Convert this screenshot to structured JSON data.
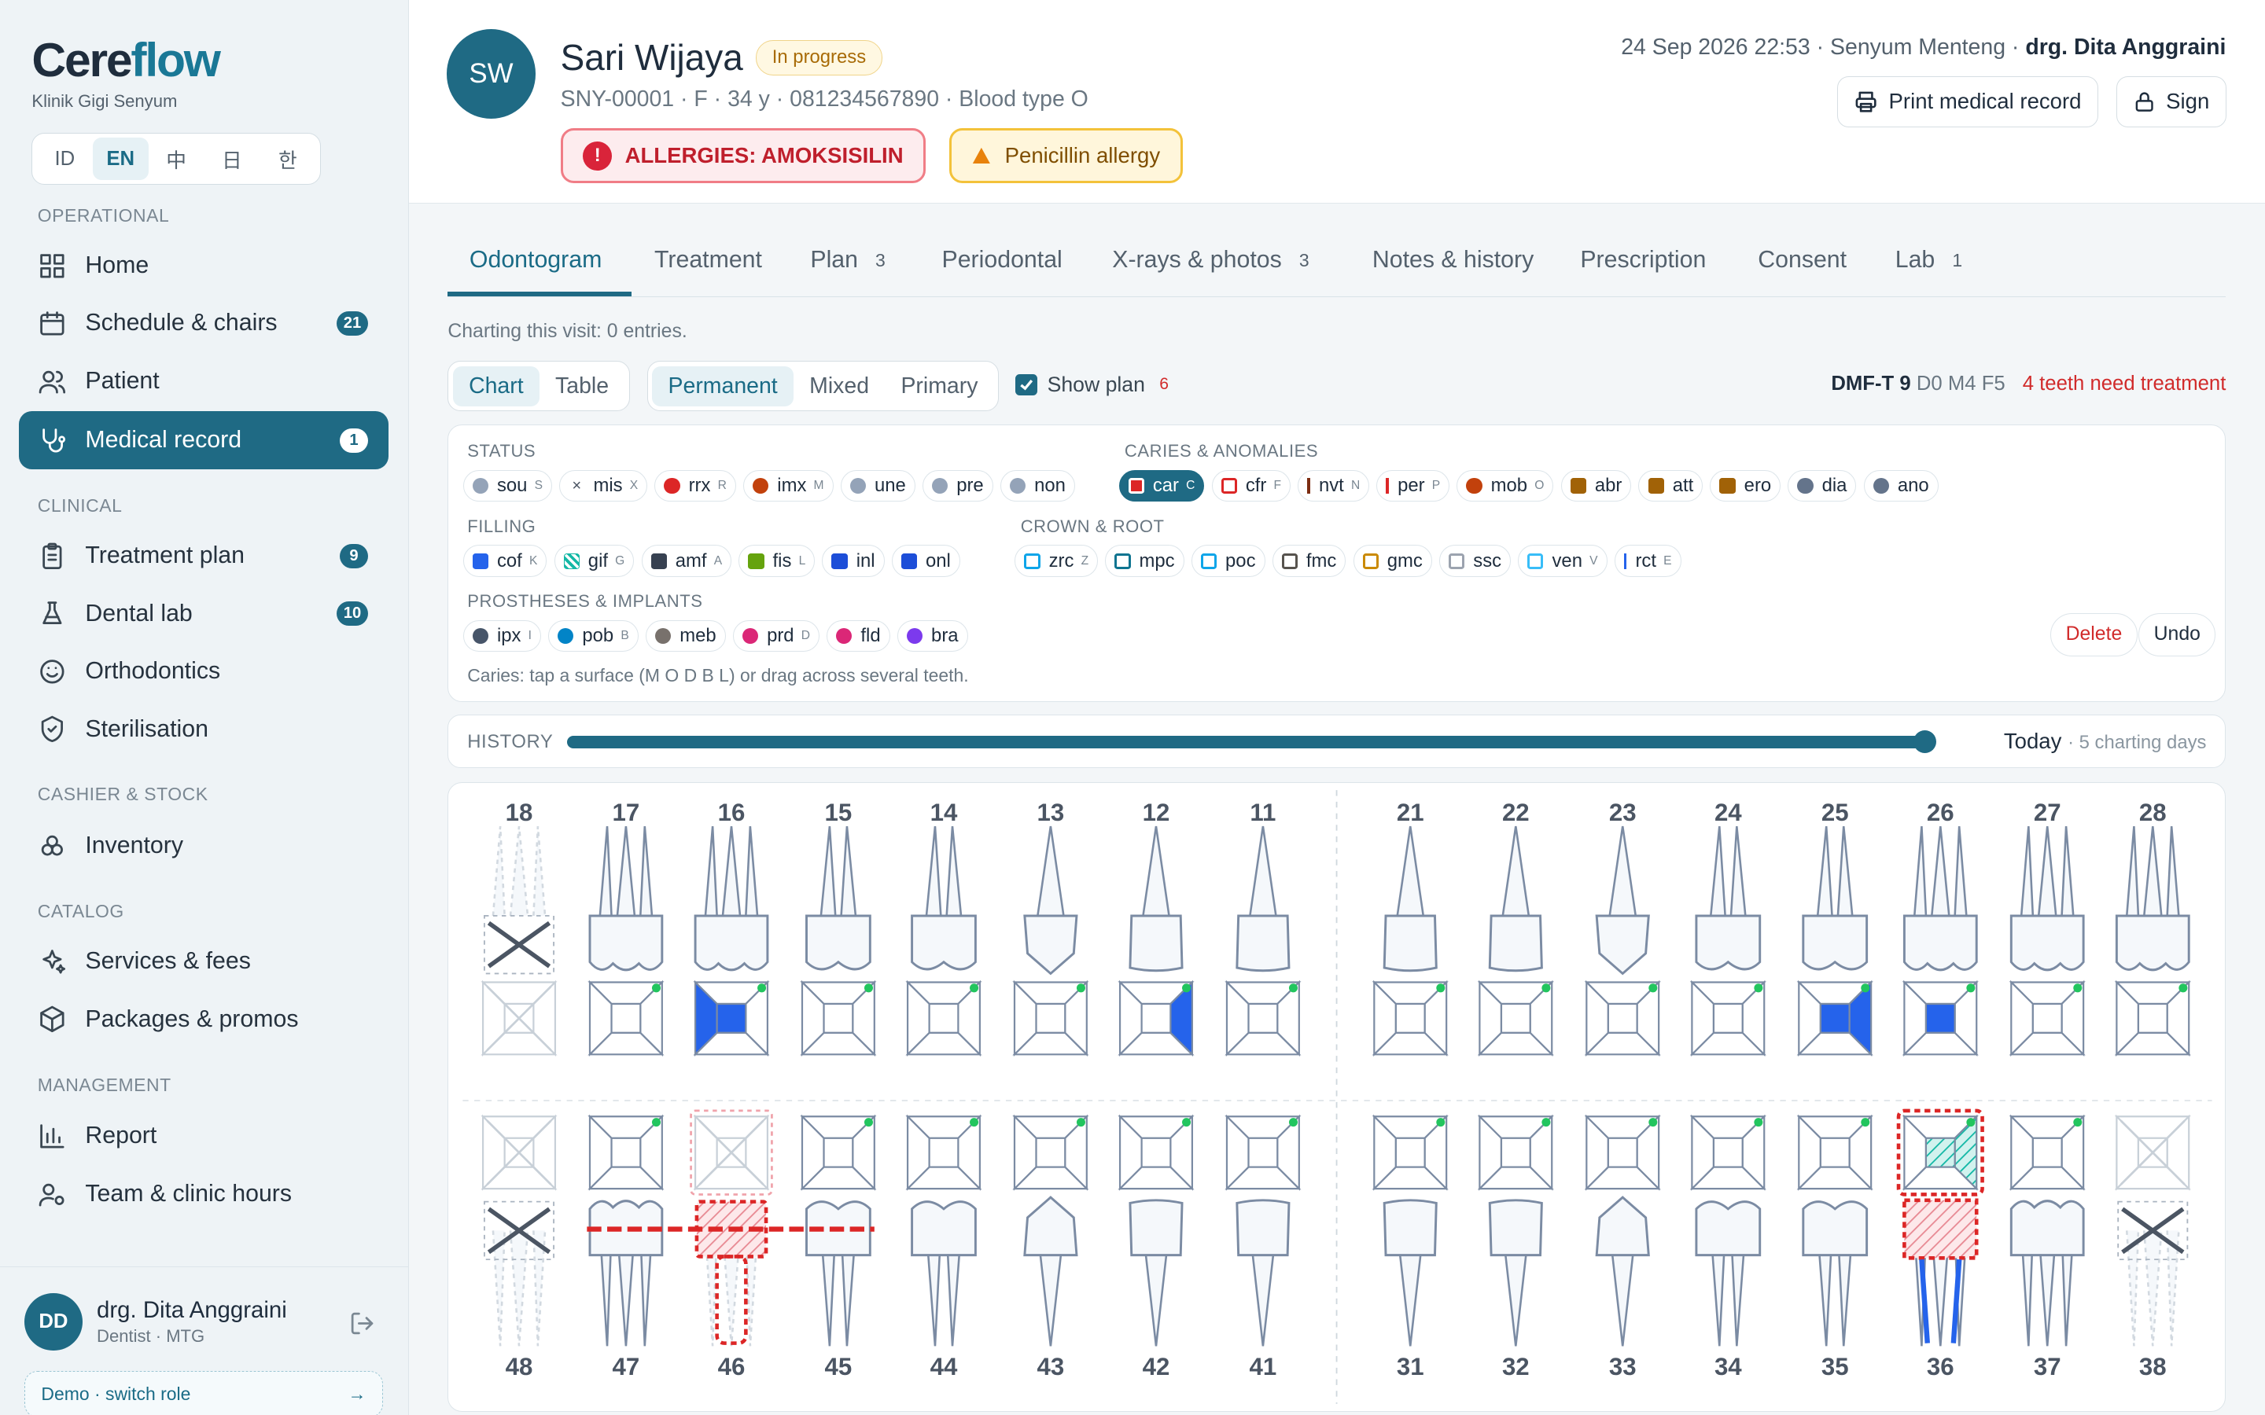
{
  "brand": {
    "name_a": "Cere",
    "name_b": "flow",
    "subtitle": "Klinik Gigi Senyum"
  },
  "languages": [
    "ID",
    "EN",
    "中",
    "日",
    "한"
  ],
  "active_language": "EN",
  "sidebar": {
    "sections": [
      "OPERATIONAL",
      "CLINICAL",
      "CASHIER & STOCK",
      "CATALOG",
      "MANAGEMENT"
    ],
    "items": [
      {
        "label": "Home",
        "icon": "grid-icon"
      },
      {
        "label": "Schedule & chairs",
        "icon": "calendar-icon",
        "badge": "21"
      },
      {
        "label": "Patient",
        "icon": "users-icon"
      },
      {
        "label": "Medical record",
        "icon": "stethoscope-icon",
        "badge": "1",
        "active": true
      },
      {
        "label": "Treatment plan",
        "icon": "clipboard-icon",
        "badge": "9"
      },
      {
        "label": "Dental lab",
        "icon": "flask-icon",
        "badge": "10"
      },
      {
        "label": "Orthodontics",
        "icon": "smile-icon"
      },
      {
        "label": "Sterilisation",
        "icon": "shield-check-icon"
      },
      {
        "label": "Inventory",
        "icon": "boxes-icon"
      },
      {
        "label": "Services & fees",
        "icon": "sparkles-icon"
      },
      {
        "label": "Packages & promos",
        "icon": "package-icon"
      },
      {
        "label": "Report",
        "icon": "bar-chart-icon"
      },
      {
        "label": "Team & clinic hours",
        "icon": "user-cog-icon"
      }
    ]
  },
  "user": {
    "initials": "DD",
    "name": "drg. Dita Anggraini",
    "role": "Dentist · MTG",
    "demo": "Demo · switch role",
    "demo_arrow": "→"
  },
  "patient": {
    "initials": "SW",
    "name": "Sari Wijaya",
    "status": "In progress",
    "meta": "SNY-00001 · F · 34 y · 081234567890 · Blood type O",
    "allergy_main": "ALLERGIES: AMOKSISILIN",
    "allergy_icon": "!",
    "allergy_second": "Penicillin allergy"
  },
  "visit": {
    "datetime": "24 Sep 2026 22:53",
    "clinic": "Senyum Menteng",
    "doctor": "drg. Dita Anggraini"
  },
  "actions": {
    "print": "Print medical record",
    "sign": "Sign"
  },
  "tabs": [
    {
      "label": "Odontogram",
      "active": true
    },
    {
      "label": "Treatment"
    },
    {
      "label": "Plan",
      "count": "3"
    },
    {
      "label": "Periodontal"
    },
    {
      "label": "X-rays & photos",
      "count": "3"
    },
    {
      "label": "Notes & history"
    },
    {
      "label": "Prescription"
    },
    {
      "label": "Consent"
    },
    {
      "label": "Lab",
      "count": "1"
    }
  ],
  "charting": {
    "count_text": "Charting this visit: 0 entries.",
    "view_modes": [
      "Chart",
      "Table"
    ],
    "dentition": [
      "Permanent",
      "Mixed",
      "Primary"
    ],
    "show_plan": "Show plan",
    "plan_count": "6",
    "dmft_label": "DMF-T 9",
    "dmft_breakdown": "D0 M4 F5",
    "need_treatment": "4 teeth need treatment"
  },
  "legend": {
    "status_title": "STATUS",
    "caries_title": "CARIES & ANOMALIES",
    "filling_title": "FILLING",
    "crown_title": "CROWN & ROOT",
    "prosth_title": "PROSTHESES & IMPLANTS",
    "status": [
      {
        "code": "sou",
        "key": "S",
        "mark": "dot",
        "color": "#94a3b8"
      },
      {
        "code": "mis",
        "key": "X",
        "mark": "x",
        "color": "#4b5563"
      },
      {
        "code": "rrx",
        "key": "R",
        "mark": "dot",
        "color": "#dc2626"
      },
      {
        "code": "imx",
        "key": "M",
        "mark": "dot",
        "color": "#c2410c"
      },
      {
        "code": "une",
        "key": "",
        "mark": "dot",
        "color": "#94a3b8"
      },
      {
        "code": "pre",
        "key": "",
        "mark": "dot",
        "color": "#94a3b8"
      },
      {
        "code": "non",
        "key": "",
        "mark": "dot",
        "color": "#94a3b8"
      }
    ],
    "caries": [
      {
        "code": "car",
        "key": "C",
        "mark": "osq",
        "color": "#dc2626",
        "active": true
      },
      {
        "code": "cfr",
        "key": "F",
        "mark": "osq",
        "color": "#dc2626"
      },
      {
        "code": "nvt",
        "key": "N",
        "mark": "bar",
        "color": "#7c2d12"
      },
      {
        "code": "per",
        "key": "P",
        "mark": "bar",
        "color": "#dc2626"
      },
      {
        "code": "mob",
        "key": "O",
        "mark": "dot",
        "color": "#c2410c"
      },
      {
        "code": "abr",
        "key": "",
        "mark": "sq",
        "color": "#a16207"
      },
      {
        "code": "att",
        "key": "",
        "mark": "sq",
        "color": "#a16207"
      },
      {
        "code": "ero",
        "key": "",
        "mark": "sq",
        "color": "#a16207"
      },
      {
        "code": "dia",
        "key": "",
        "mark": "dot",
        "color": "#64748b"
      },
      {
        "code": "ano",
        "key": "",
        "mark": "dot",
        "color": "#64748b"
      }
    ],
    "filling": [
      {
        "code": "cof",
        "key": "K",
        "mark": "sq",
        "color": "#2563eb"
      },
      {
        "code": "gif",
        "key": "G",
        "mark": "sq",
        "color": "#14b8a6"
      },
      {
        "code": "amf",
        "key": "A",
        "mark": "sq",
        "color": "#374151"
      },
      {
        "code": "fis",
        "key": "L",
        "mark": "sq",
        "color": "#65a30d"
      },
      {
        "code": "inl",
        "key": "",
        "mark": "sq",
        "color": "#1d4ed8"
      },
      {
        "code": "onl",
        "key": "",
        "mark": "sq",
        "color": "#1d4ed8"
      }
    ],
    "crown": [
      {
        "code": "zrc",
        "key": "Z",
        "mark": "osq",
        "color": "#0ea5e9"
      },
      {
        "code": "mpc",
        "key": "",
        "mark": "osq",
        "color": "#0e7490"
      },
      {
        "code": "poc",
        "key": "",
        "mark": "osq",
        "color": "#0ea5e9"
      },
      {
        "code": "fmc",
        "key": "",
        "mark": "osq",
        "color": "#57534e"
      },
      {
        "code": "gmc",
        "key": "",
        "mark": "osq",
        "color": "#ca8a04"
      },
      {
        "code": "ssc",
        "key": "",
        "mark": "osq",
        "color": "#9ca3af"
      },
      {
        "code": "ven",
        "key": "V",
        "mark": "osq",
        "color": "#38bdf8"
      },
      {
        "code": "rct",
        "key": "E",
        "mark": "bar",
        "color": "#2563eb"
      }
    ],
    "prosth": [
      {
        "code": "ipx",
        "key": "I",
        "mark": "dot",
        "color": "#475569"
      },
      {
        "code": "pob",
        "key": "B",
        "mark": "dot",
        "color": "#0284c7"
      },
      {
        "code": "meb",
        "key": "",
        "mark": "dot",
        "color": "#78716c"
      },
      {
        "code": "prd",
        "key": "D",
        "mark": "dot",
        "color": "#db2777"
      },
      {
        "code": "fld",
        "key": "",
        "mark": "dot",
        "color": "#db2777"
      },
      {
        "code": "bra",
        "key": "",
        "mark": "dot",
        "color": "#7c3aed"
      }
    ],
    "hint": "Caries: tap a surface (M O D B L) or drag across several teeth.",
    "delete": "Delete",
    "undo": "Undo"
  },
  "history": {
    "title": "HISTORY",
    "today": "Today",
    "days": "· 5 charting days",
    "position": 1.0
  },
  "colors": {
    "accent": "#1f6a84",
    "caries": "#dc2626",
    "filling": "#2563eb",
    "gic": "#14b8a6",
    "tooth": "#64748b"
  },
  "odontogram": {
    "upper": [
      {
        "n": "18",
        "type": "molar",
        "state": "missing",
        "surf": []
      },
      {
        "n": "17",
        "type": "molar",
        "surf": []
      },
      {
        "n": "16",
        "type": "molar",
        "surf": [
          "D",
          "O"
        ]
      },
      {
        "n": "15",
        "type": "premolar",
        "surf": []
      },
      {
        "n": "14",
        "type": "premolar",
        "surf": []
      },
      {
        "n": "13",
        "type": "canine",
        "surf": []
      },
      {
        "n": "12",
        "type": "incisor",
        "surf": [
          "M"
        ]
      },
      {
        "n": "11",
        "type": "incisor",
        "surf": []
      },
      {
        "n": "21",
        "type": "incisor",
        "surf": []
      },
      {
        "n": "22",
        "type": "incisor",
        "surf": []
      },
      {
        "n": "23",
        "type": "canine",
        "surf": []
      },
      {
        "n": "24",
        "type": "premolar",
        "surf": []
      },
      {
        "n": "25",
        "type": "premolar",
        "surf": [
          "D",
          "O"
        ]
      },
      {
        "n": "26",
        "type": "molar",
        "surf": [
          "O"
        ]
      },
      {
        "n": "27",
        "type": "molar",
        "surf": []
      },
      {
        "n": "28",
        "type": "molar",
        "surf": []
      }
    ],
    "lower": [
      {
        "n": "48",
        "type": "molar",
        "state": "missing",
        "surf": []
      },
      {
        "n": "47",
        "type": "molar",
        "surf": []
      },
      {
        "n": "46",
        "type": "molar",
        "state": "planned-extraction",
        "surf": []
      },
      {
        "n": "45",
        "type": "premolar",
        "surf": []
      },
      {
        "n": "44",
        "type": "premolar",
        "surf": []
      },
      {
        "n": "43",
        "type": "canine",
        "surf": []
      },
      {
        "n": "42",
        "type": "incisor",
        "surf": []
      },
      {
        "n": "41",
        "type": "incisor",
        "surf": []
      },
      {
        "n": "31",
        "type": "incisor",
        "surf": []
      },
      {
        "n": "32",
        "type": "incisor",
        "surf": []
      },
      {
        "n": "33",
        "type": "canine",
        "surf": []
      },
      {
        "n": "34",
        "type": "premolar",
        "surf": []
      },
      {
        "n": "35",
        "type": "premolar",
        "surf": []
      },
      {
        "n": "36",
        "type": "molar",
        "state": "planned-crown-rct",
        "gic": [
          "D",
          "O"
        ],
        "surf": []
      },
      {
        "n": "37",
        "type": "molar",
        "surf": []
      },
      {
        "n": "38",
        "type": "molar",
        "state": "missing",
        "surf": []
      }
    ],
    "bridge": {
      "from": "47",
      "to": "45"
    }
  }
}
